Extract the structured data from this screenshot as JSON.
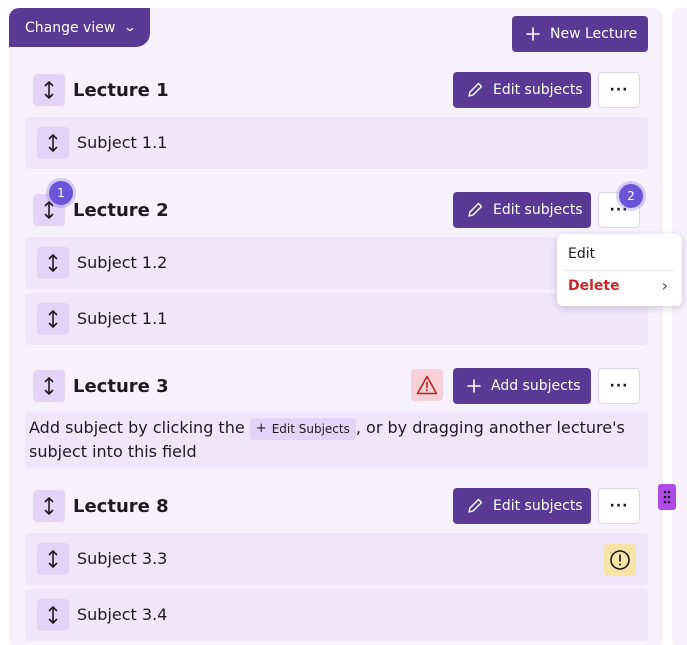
{
  "toolbar": {
    "change_view_label": "Change view",
    "new_lecture_label": "New Lecture"
  },
  "lectures": [
    {
      "title": "Lecture 1",
      "action_label": "Edit subjects",
      "more_label": "···",
      "subjects": [
        "Subject 1.1"
      ]
    },
    {
      "title": "Lecture 2",
      "action_label": "Edit subjects",
      "more_label": "···",
      "subjects": [
        "Subject 1.2",
        "Subject 1.1"
      ],
      "badges": [
        "1",
        "2"
      ]
    },
    {
      "title": "Lecture 3",
      "action_label": "Add subjects",
      "more_label": "···",
      "hint_before": "Add subject by clicking the ",
      "hint_chip": "Edit Subjects",
      "hint_after": ", or by dragging another lecture's subject into this field"
    },
    {
      "title": "Lecture 8",
      "action_label": "Edit subjects",
      "more_label": "···",
      "subjects": [
        "Subject 3.3",
        "Subject 3.4"
      ]
    }
  ],
  "context_menu": {
    "edit_label": "Edit",
    "delete_label": "Delete"
  },
  "colors": {
    "primary": "#5b3a96",
    "panel_bg": "#f6f1fd",
    "handle_bg": "#e3d3f7",
    "danger": "#c62828",
    "badge": "#6a55d9"
  }
}
